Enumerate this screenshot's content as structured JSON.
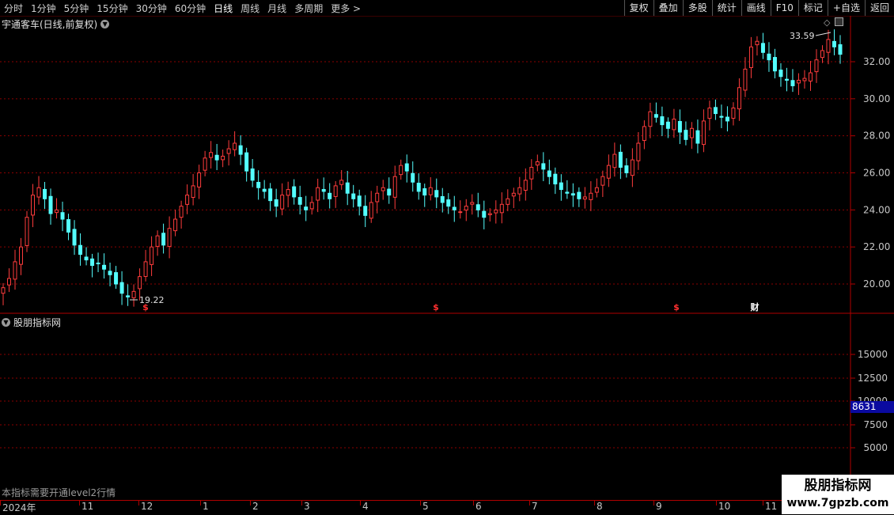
{
  "toolbar": {
    "periods": [
      "分时",
      "1分钟",
      "5分钟",
      "15分钟",
      "30分钟",
      "60分钟",
      "日线",
      "周线",
      "月线",
      "多周期",
      "更多 >"
    ],
    "active_period": "日线",
    "actions": [
      "复权",
      "叠加",
      "多股",
      "统计",
      "画线",
      "F10",
      "标记",
      "+自选",
      "返回"
    ]
  },
  "main_chart": {
    "title": "宇通客车(日线,前复权)",
    "y_labels": [
      "32.00",
      "30.00",
      "28.00",
      "26.00",
      "24.00",
      "22.00",
      "20.00"
    ],
    "high_label": "33.59",
    "low_label": "19.22",
    "markers": [
      {
        "text": "$",
        "color": "#ff3030"
      },
      {
        "text": "$",
        "color": "#ff3030"
      },
      {
        "text": "$",
        "color": "#ff3030"
      },
      {
        "text": "财",
        "color": "#ffffff"
      }
    ]
  },
  "sub_chart": {
    "title": "股朋指标网",
    "y_labels": [
      "15000",
      "12500",
      "10000",
      "7500",
      "5000"
    ],
    "current_value": "8631",
    "note": "本指标需要开通level2行情"
  },
  "x_axis": {
    "labels": [
      "2024年",
      "11",
      "12",
      "1",
      "2",
      "3",
      "4",
      "5",
      "6",
      "7",
      "8",
      "9",
      "10",
      "11"
    ]
  },
  "watermark": {
    "line1": "股朋指标网",
    "line2": "www.7gpzb.com"
  },
  "colors": {
    "up": "#ff3c3c",
    "down": "#54ffff",
    "grid": "#8b0000",
    "axis": "#b00000"
  },
  "chart_data": {
    "type": "candlestick",
    "x_period": "daily",
    "ylim": [
      19,
      33.6
    ],
    "high": 33.59,
    "low": 19.22,
    "closes": [
      19.8,
      20.3,
      21.2,
      22.0,
      23.6,
      24.8,
      25.2,
      24.6,
      23.8,
      24.0,
      23.5,
      22.8,
      22.1,
      21.6,
      21.3,
      21.0,
      21.1,
      20.8,
      20.5,
      20.0,
      19.5,
      19.3,
      19.6,
      20.4,
      21.2,
      22.0,
      22.6,
      22.1,
      23.0,
      23.5,
      24.2,
      24.8,
      25.3,
      26.0,
      26.8,
      27.1,
      26.7,
      26.9,
      27.3,
      27.6,
      27.0,
      26.1,
      25.6,
      25.2,
      25.0,
      24.5,
      24.2,
      24.8,
      25.1,
      24.7,
      24.3,
      24.0,
      24.4,
      25.2,
      25.0,
      24.6,
      25.3,
      25.6,
      24.9,
      24.6,
      24.2,
      23.7,
      24.4,
      24.9,
      25.2,
      24.8,
      25.8,
      26.4,
      26.1,
      25.5,
      25.0,
      24.8,
      25.2,
      24.7,
      24.4,
      24.2,
      24.0,
      23.9,
      24.2,
      24.4,
      24.0,
      23.6,
      23.8,
      24.0,
      24.3,
      24.6,
      24.9,
      25.2,
      25.6,
      26.3,
      26.6,
      26.2,
      25.8,
      25.4,
      25.1,
      24.9,
      24.8,
      24.6,
      24.7,
      24.9,
      25.2,
      25.8,
      26.4,
      27.0,
      26.3,
      26.0,
      26.7,
      27.6,
      28.5,
      29.3,
      29.0,
      28.6,
      28.4,
      28.9,
      28.2,
      27.8,
      28.4,
      27.6,
      28.8,
      29.5,
      29.2,
      29.0,
      28.8,
      29.5,
      30.6,
      31.6,
      32.8,
      33.1,
      32.5,
      32.1,
      31.5,
      31.2,
      31.0,
      30.7,
      31.0,
      31.1,
      31.4,
      32.1,
      32.6,
      33.2,
      32.8,
      32.4
    ]
  }
}
